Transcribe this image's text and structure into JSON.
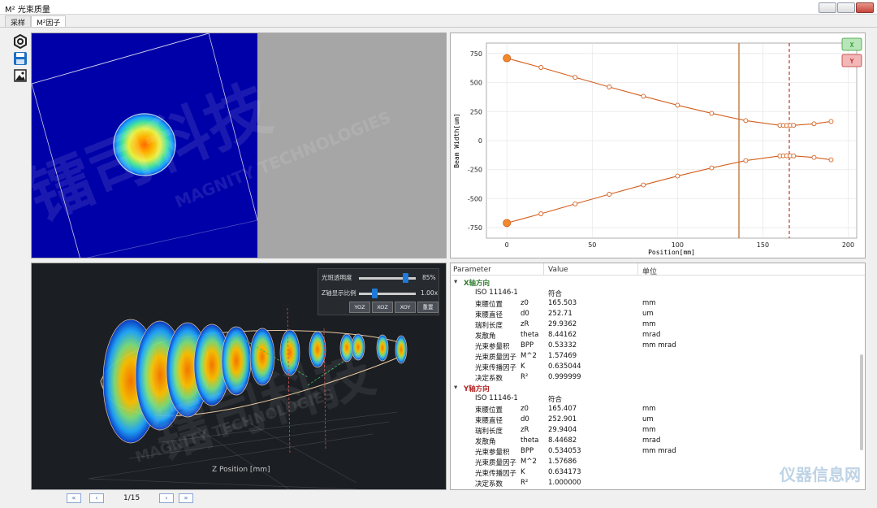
{
  "window": {
    "title": "M² 光束质量"
  },
  "tabs": [
    {
      "label": "采样"
    },
    {
      "label": "M²因子"
    }
  ],
  "toolbar": {
    "icons": [
      "settings-icon",
      "save-icon",
      "image-icon"
    ]
  },
  "camera_view": {
    "watermark_cn": "镭司科技",
    "watermark_en": "MAGNITY TECHNOLOGIES"
  },
  "chart_data": {
    "type": "line",
    "xlabel": "Position[mm]",
    "ylabel": "Beam Width[um]",
    "xlim": [
      -12,
      205
    ],
    "ylim": [
      -840,
      840
    ],
    "xticks": [
      0,
      50,
      100,
      150,
      200
    ],
    "yticks": [
      750,
      500,
      250,
      0,
      -250,
      -500,
      -750
    ],
    "grid": true,
    "series": [
      {
        "x": [
          0,
          20,
          40,
          60,
          80,
          100,
          120,
          140,
          160,
          162,
          164,
          166,
          168,
          180,
          190
        ],
        "values": [
          710,
          630,
          545,
          462,
          382,
          305,
          235,
          172,
          132,
          131,
          130,
          131,
          132,
          145,
          165
        ]
      },
      {
        "x": [
          0,
          20,
          40,
          60,
          80,
          100,
          120,
          140,
          160,
          162,
          164,
          166,
          168,
          180,
          190
        ],
        "values": [
          -710,
          -630,
          -545,
          -462,
          -382,
          -305,
          -235,
          -172,
          -132,
          -131,
          -130,
          -131,
          -132,
          -145,
          -165
        ]
      }
    ],
    "markers": {
      "solid_line_x": 136,
      "dashed_line_x": 165.5
    },
    "legend_buttons": [
      {
        "label": "X",
        "color": "#3a9b3a"
      },
      {
        "label": "Y",
        "color": "#c03030"
      }
    ]
  },
  "view3d": {
    "controls": {
      "opacity_label": "光斑透明度",
      "opacity_value": "85%",
      "zscale_label": "Z轴显示比例",
      "zscale_value": "1.00x",
      "buttons": [
        "YOZ",
        "XOZ",
        "XOY",
        "重置"
      ]
    },
    "axis_label": "Z Position [mm]",
    "watermark_cn": "镭司科技",
    "watermark_en": "MAGNITY TECHNOLOGIES"
  },
  "results": {
    "headers": [
      "Parameter",
      "Value",
      "单位"
    ],
    "groups": [
      {
        "title": "X轴方向",
        "color": "#2c7a2c",
        "rows": [
          [
            "ISO 11146-1",
            "",
            "符合",
            ""
          ],
          [
            "束腰位置",
            "z0",
            "165.503",
            "mm"
          ],
          [
            "束腰直径",
            "d0",
            "252.71",
            "um"
          ],
          [
            "瑞利长度",
            "zR",
            "29.9362",
            "mm"
          ],
          [
            "发散角",
            "theta",
            "8.44162",
            "mrad"
          ],
          [
            "光束参量积",
            "BPP",
            "0.53332",
            "mm mrad"
          ],
          [
            "光束质量因子",
            "M^2",
            "1.57469",
            ""
          ],
          [
            "光束传播因子",
            "K",
            "0.635044",
            ""
          ],
          [
            "决定系数",
            "R²",
            "0.999999",
            ""
          ]
        ]
      },
      {
        "title": "Y轴方向",
        "color": "#b02020",
        "rows": [
          [
            "ISO 11146-1",
            "",
            "符合",
            ""
          ],
          [
            "束腰位置",
            "z0",
            "165.407",
            "mm"
          ],
          [
            "束腰直径",
            "d0",
            "252.901",
            "um"
          ],
          [
            "瑞利长度",
            "zR",
            "29.9404",
            "mm"
          ],
          [
            "发散角",
            "theta",
            "8.44682",
            "mrad"
          ],
          [
            "光束参量积",
            "BPP",
            "0.534053",
            "mm mrad"
          ],
          [
            "光束质量因子",
            "M^2",
            "1.57686",
            ""
          ],
          [
            "光束传播因子",
            "K",
            "0.634173",
            ""
          ],
          [
            "决定系数",
            "R²",
            "1.000000",
            ""
          ]
        ]
      }
    ]
  },
  "pager": {
    "page": "1/15",
    "first": "«",
    "prev": "‹",
    "next": "›",
    "last": "»"
  },
  "corner_watermark": "仪器信息网"
}
